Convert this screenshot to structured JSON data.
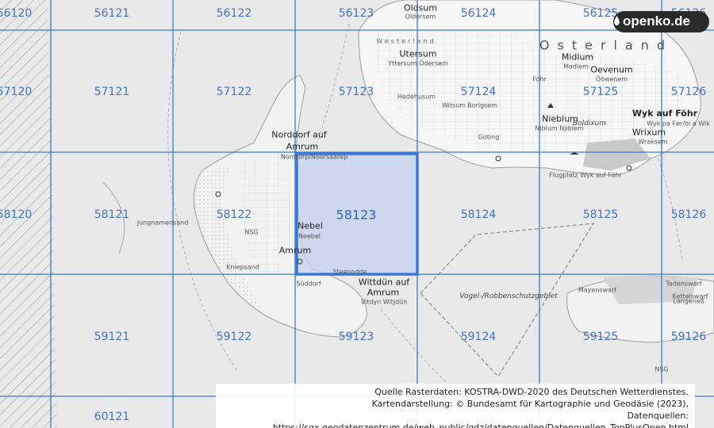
{
  "brand": {
    "logo_text": "openko.de"
  },
  "highlight_cell": "58123",
  "grid_labels": [
    {
      "row": 0,
      "col": 0,
      "text": "56120"
    },
    {
      "row": 0,
      "col": 1,
      "text": "56121"
    },
    {
      "row": 0,
      "col": 2,
      "text": "56122"
    },
    {
      "row": 0,
      "col": 3,
      "text": "56123"
    },
    {
      "row": 0,
      "col": 4,
      "text": "56124"
    },
    {
      "row": 0,
      "col": 5,
      "text": "56125"
    },
    {
      "row": 0,
      "col": 6,
      "text": "56126"
    },
    {
      "row": 1,
      "col": 0,
      "text": "57120"
    },
    {
      "row": 1,
      "col": 1,
      "text": "57121"
    },
    {
      "row": 1,
      "col": 2,
      "text": "57122"
    },
    {
      "row": 1,
      "col": 3,
      "text": "57123"
    },
    {
      "row": 1,
      "col": 4,
      "text": "57124"
    },
    {
      "row": 1,
      "col": 5,
      "text": "57125"
    },
    {
      "row": 1,
      "col": 6,
      "text": "57126"
    },
    {
      "row": 2,
      "col": 0,
      "text": "58120"
    },
    {
      "row": 2,
      "col": 1,
      "text": "58121"
    },
    {
      "row": 2,
      "col": 2,
      "text": "58122"
    },
    {
      "row": 2,
      "col": 3,
      "text": "58123"
    },
    {
      "row": 2,
      "col": 4,
      "text": "58124"
    },
    {
      "row": 2,
      "col": 5,
      "text": "58125"
    },
    {
      "row": 2,
      "col": 6,
      "text": "58126"
    },
    {
      "row": 3,
      "col": 1,
      "text": "59121"
    },
    {
      "row": 3,
      "col": 2,
      "text": "59122"
    },
    {
      "row": 3,
      "col": 3,
      "text": "59123"
    },
    {
      "row": 3,
      "col": 4,
      "text": "59124"
    },
    {
      "row": 3,
      "col": 5,
      "text": "59125"
    },
    {
      "row": 3,
      "col": 6,
      "text": "59126"
    },
    {
      "row": 4,
      "col": 1,
      "text": "60121"
    }
  ],
  "places": [
    {
      "text": "Oldsum",
      "style": "big"
    },
    {
      "text": "Oldersem",
      "style": "small"
    },
    {
      "text": "Westerland",
      "style": "sea2"
    },
    {
      "text": "Utersum",
      "style": "big"
    },
    {
      "text": "Yttersum Ödersem",
      "style": "small"
    },
    {
      "text": "Osterland",
      "style": "sea"
    },
    {
      "text": "Midlum",
      "style": "big"
    },
    {
      "text": "Madlem",
      "style": "small"
    },
    {
      "text": "Oevenum",
      "style": "big"
    },
    {
      "text": "Ööwenem",
      "style": "small"
    },
    {
      "text": "Föhr",
      "style": "small"
    },
    {
      "text": "Hedehusum",
      "style": "small"
    },
    {
      "text": "Witsum",
      "style": "small"
    },
    {
      "text": "Borigsem",
      "style": "small"
    },
    {
      "text": "Nieblum",
      "style": "big"
    },
    {
      "text": "Niblum Njiblem",
      "style": "small"
    },
    {
      "text": "Boldixum",
      "style": "italic"
    },
    {
      "text": "Wyk auf Föhr",
      "style": "bold"
    },
    {
      "text": "Wyk pa Før/bi a Wik",
      "style": "small"
    },
    {
      "text": "Wrixum",
      "style": "big"
    },
    {
      "text": "Wraksem",
      "style": "small"
    },
    {
      "text": "Goting",
      "style": "small"
    },
    {
      "text": "Flugplatz Wyk auf Föhr",
      "style": "small"
    },
    {
      "text": "Norddorf auf",
      "style": "big"
    },
    {
      "text": "Amrum",
      "style": "big"
    },
    {
      "text": "Nordtorp/Noorsaarep",
      "style": "small"
    },
    {
      "text": "Nebel",
      "style": "big"
    },
    {
      "text": "Neebel",
      "style": "small"
    },
    {
      "text": "Amrum",
      "style": "big"
    },
    {
      "text": "Kniepsand",
      "style": "small"
    },
    {
      "text": "Süddorf",
      "style": "small"
    },
    {
      "text": "Steenodde",
      "style": "small"
    },
    {
      "text": "Wittdün auf",
      "style": "big"
    },
    {
      "text": "Amrum",
      "style": "big"
    },
    {
      "text": "Vitdyn Witjdün",
      "style": "small"
    },
    {
      "text": "Jungnamensand",
      "style": "small"
    },
    {
      "text": "NSG",
      "style": "small"
    },
    {
      "text": "Vogel-/Robbenschutzgebiet",
      "style": "italic"
    },
    {
      "text": "Mayenswarf",
      "style": "small"
    },
    {
      "text": "Kettelswarf",
      "style": "small"
    },
    {
      "text": "Langeneß",
      "style": "small"
    },
    {
      "text": "Tadenswarf",
      "style": "small"
    },
    {
      "text": "NSG",
      "style": "small"
    }
  ],
  "credits": {
    "line1": "Quelle Rasterdaten: KOSTRA-DWD-2020 des Deutschen Wetterdienstes.",
    "line2": "Kartendarstellung: © Bundesamt für Kartographie und Geodäsie (2023),",
    "line3": "Datenquellen: https://sgx.geodatenzentrum.de/web_public/gdz/datenquellen/Datenquellen_TopPlusOpen.html"
  },
  "colors": {
    "grid": "#3a78d8",
    "highlight_fill": "#c3d2ef",
    "highlight_border": "#3a78d8",
    "land": "#f7f7f7",
    "sea": "#e8e8e8"
  }
}
